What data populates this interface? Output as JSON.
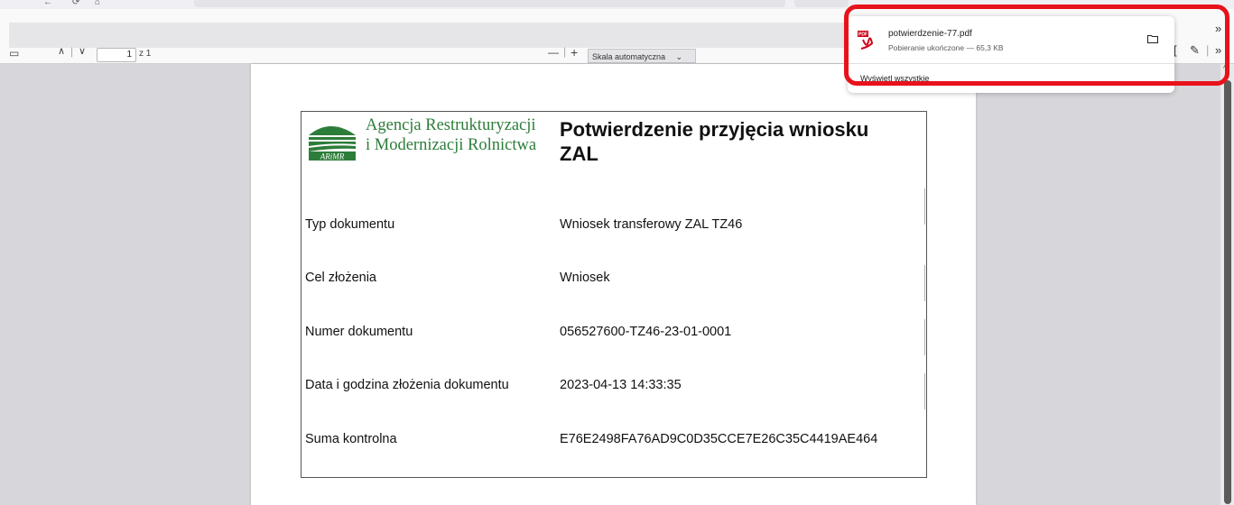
{
  "pdf_toolbar": {
    "page_current": "1",
    "page_total": "z 1",
    "zoom_minus": "—",
    "zoom_plus": "+",
    "zoom_value": "Skala automatyczna"
  },
  "document": {
    "agency_line1": "Agencja Restrukturyzacji",
    "agency_line2": "i Modernizacji Rolnictwa",
    "logo_text": "ARiMR",
    "title_line1": "Potwierdzenie przyjęcia wniosku",
    "title_line2": "ZAL",
    "rows": [
      {
        "label": "Typ dokumentu",
        "value": "Wniosek transferowy ZAL TZ46"
      },
      {
        "label": "Cel złożenia",
        "value": "Wniosek"
      },
      {
        "label": "Numer dokumentu",
        "value": "056527600-TZ46-23-01-0001"
      },
      {
        "label": "Data i godzina złożenia dokumentu",
        "value": "2023-04-13 14:33:35"
      },
      {
        "label": "Suma kontrolna",
        "value": "E76E2498FA76AD9C0D35CCE7E26C35C4419AE464"
      }
    ]
  },
  "download_popup": {
    "file_name": "potwierdzenie-77.pdf",
    "status": "Pobieranie ukończone — 65,3 KB",
    "show_all": "Wyświetl wszystkie",
    "highlight_color": "#e8121b"
  },
  "colors": {
    "agency_green": "#2d7d3a",
    "pdf_red": "#d0021b"
  }
}
